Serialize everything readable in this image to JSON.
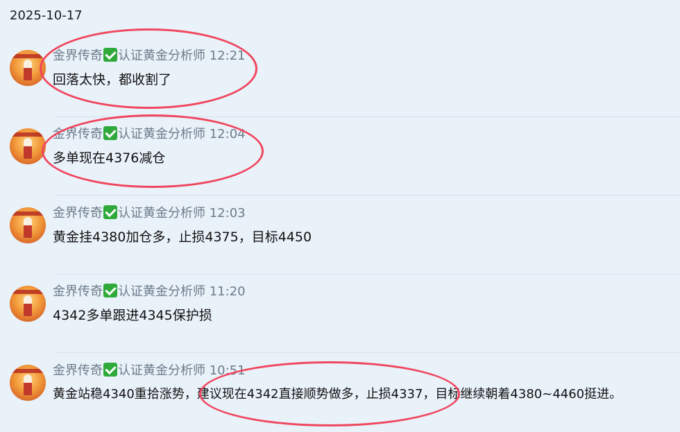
{
  "date_header": "2025-10-17",
  "messages": [
    {
      "sender": "金界传奇",
      "role": "认证黄金分析师",
      "time": "12:21",
      "text": "回落太快，都收割了"
    },
    {
      "sender": "金界传奇",
      "role": "认证黄金分析师",
      "time": "12:04",
      "text": "多单现在4376减仓"
    },
    {
      "sender": "金界传奇",
      "role": "认证黄金分析师",
      "time": "12:03",
      "text": "黄金挂4380加仓多，止损4375，目标4450"
    },
    {
      "sender": "金界传奇",
      "role": "认证黄金分析师",
      "time": "11:20",
      "text": "4342多单跟进4345保护损"
    },
    {
      "sender": "金界传奇",
      "role": "认证黄金分析师",
      "time": "10:51",
      "text": "黄金站稳4340重拾涨势，建议现在4342直接顺势做多，止损4337，目标继续朝着4380~4460挺进。"
    }
  ],
  "colors": {
    "background": "#e9f1f9",
    "annotation": "#f0465e",
    "verified": "#2faa3a",
    "header_text": "#6b7c8a"
  },
  "icons": [
    "avatar",
    "verified-check-icon"
  ]
}
